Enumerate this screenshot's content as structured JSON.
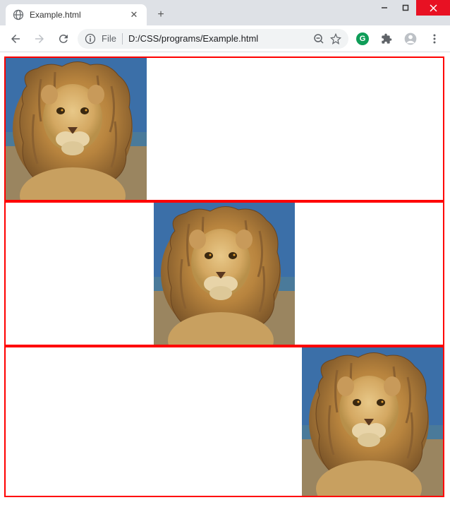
{
  "window": {
    "minimize_icon": "−",
    "maximize_icon": "□",
    "close_icon": "✕"
  },
  "tab": {
    "title": "Example.html",
    "close_icon": "✕",
    "new_tab_icon": "+"
  },
  "toolbar": {
    "nav_back": "←",
    "nav_forward": "→",
    "reload": "⟳",
    "file_prefix": "File",
    "url": "D:/CSS/programs/Example.html",
    "zoom_icon": "⊖",
    "bookmark_icon": "☆",
    "menu_icon": "⋮"
  },
  "content": {
    "boxes": [
      {
        "align": "left"
      },
      {
        "align": "center"
      },
      {
        "align": "right"
      }
    ]
  }
}
